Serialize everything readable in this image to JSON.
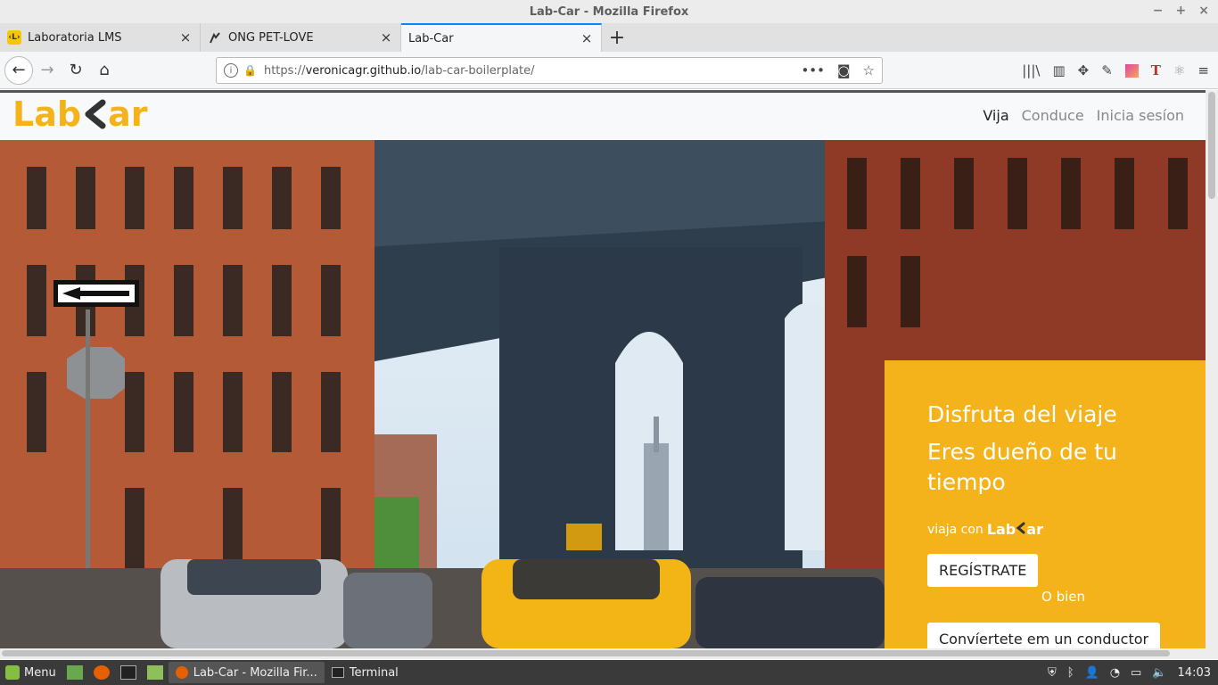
{
  "window": {
    "title": "Lab-Car - Mozilla Firefox"
  },
  "tabs": [
    {
      "label": "Laboratoria LMS",
      "icon": "laboratoria-icon"
    },
    {
      "label": "ONG PET-LOVE",
      "icon": "paw-icon"
    },
    {
      "label": "Lab-Car",
      "icon": "none"
    }
  ],
  "url": {
    "proto": "https://",
    "host": "veronicagr.github.io",
    "path": "/lab-car-boilerplate/"
  },
  "site": {
    "logo_left": "Lab",
    "logo_right": "ar",
    "menu": [
      "Vija",
      "Conduce",
      "Inicia sesíon"
    ]
  },
  "cta": {
    "headline1": "Disfruta del viaje",
    "headline2": "Eres dueño de tu tiempo",
    "viaja_con": "viaja con",
    "brand_mini_left": "Lab",
    "brand_mini_right": "ar",
    "register_button": "REGÍSTRATE",
    "or_text": "O bien",
    "driver_button": "Convíertete em un conductor"
  },
  "taskbar": {
    "menu_label": "Menu",
    "windows": [
      "Lab-Car - Mozilla Fir...",
      "Terminal"
    ],
    "clock": "14:03"
  },
  "colors": {
    "brand": "#f5b31b",
    "dark": "#333333"
  }
}
